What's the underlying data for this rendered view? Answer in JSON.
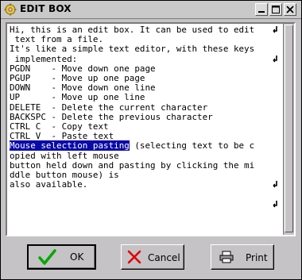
{
  "window": {
    "title": "EDIT BOX"
  },
  "titlebar": {
    "icons": [
      "app-gear-icon",
      "minimize-icon",
      "maximize-icon",
      "close-icon"
    ]
  },
  "editor": {
    "lines": [
      "Hi, this is an edit box. It can be used to edit",
      " text from a file.",
      "",
      "It's like a simple text editor, with these keys",
      " implemented:",
      "",
      "PGDN    - Move down one page",
      "PGUP    - Move up one page",
      "DOWN    - Move down one line",
      "UP      - Move up one line",
      "DELETE  - Delete the current character",
      "BACKSPC - Delete the previous character",
      "CTRL C  - Copy text",
      "CTRL V  - Paste text",
      "",
      "",
      " (selecting text to be c",
      "opied with left mouse",
      "button held down and pasting by clicking the mi",
      "ddle button mouse) is",
      "also available."
    ],
    "selected_text": "Mouse selection pasting"
  },
  "buttons": {
    "ok": {
      "label": "OK",
      "icon": "checkmark-icon",
      "accent": "#00a800"
    },
    "cancel": {
      "label": "Cancel",
      "icon": "cross-icon",
      "accent": "#e00000"
    },
    "print": {
      "label": "Print",
      "icon": "printer-icon"
    }
  }
}
